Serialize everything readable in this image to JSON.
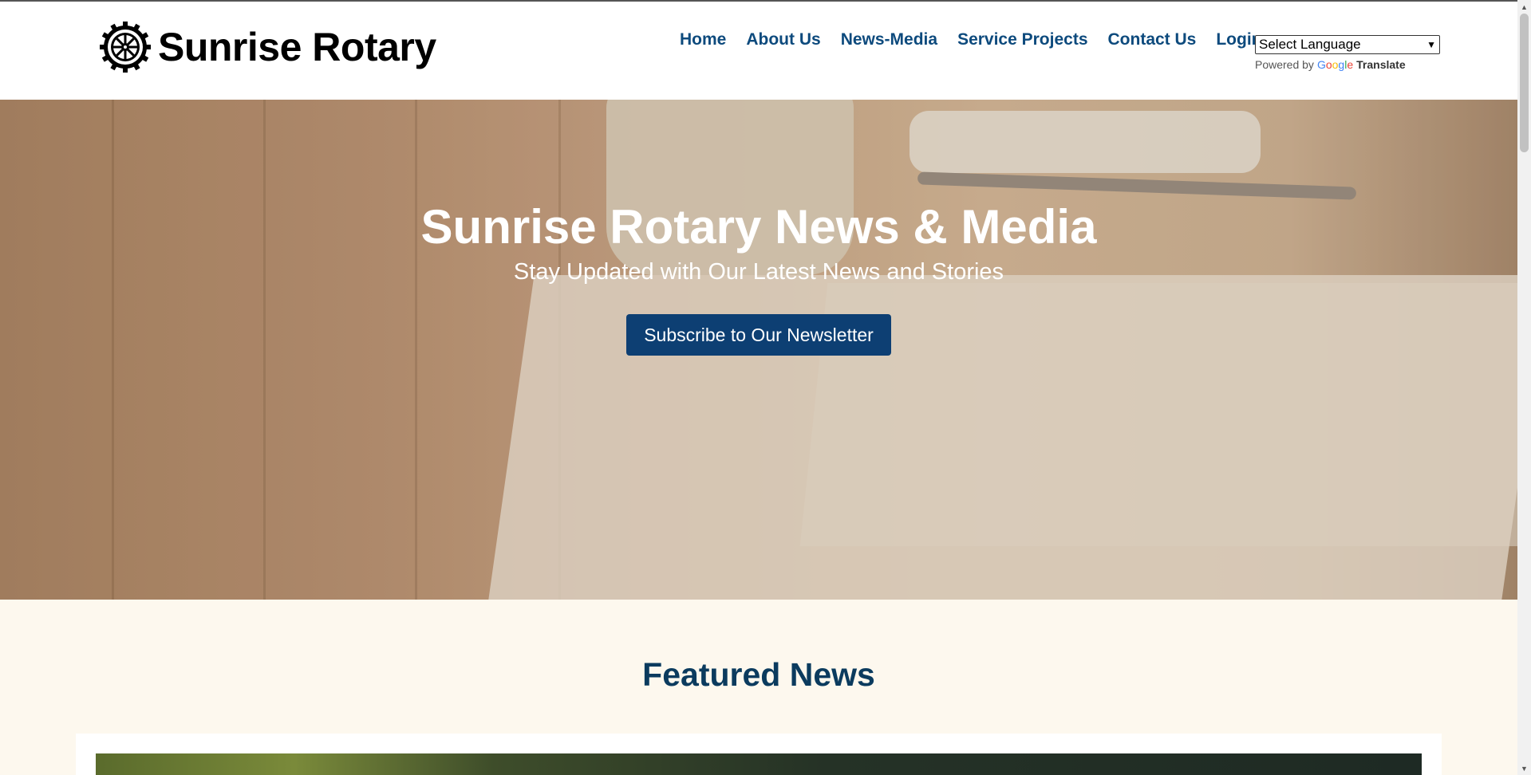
{
  "brand": {
    "name": "Sunrise Rotary",
    "logo_icon": "rotary-wheel-icon"
  },
  "nav": {
    "items": [
      {
        "label": "Home"
      },
      {
        "label": "About Us"
      },
      {
        "label": "News-Media"
      },
      {
        "label": "Service Projects"
      },
      {
        "label": "Contact Us"
      },
      {
        "label": "Login"
      }
    ]
  },
  "translate": {
    "select_value": "Select Language",
    "powered_by": "Powered by",
    "google": "Google",
    "translate_label": "Translate"
  },
  "hero": {
    "title": "Sunrise Rotary News & Media",
    "subtitle": "Stay Updated with Our Latest News and Stories",
    "cta_label": "Subscribe to Our Newsletter"
  },
  "featured": {
    "title": "Featured News"
  },
  "colors": {
    "nav_link": "#0d4a7d",
    "cta_background": "#0d3f73",
    "section_background": "#fdf8ee",
    "featured_title": "#0b3b5e"
  }
}
